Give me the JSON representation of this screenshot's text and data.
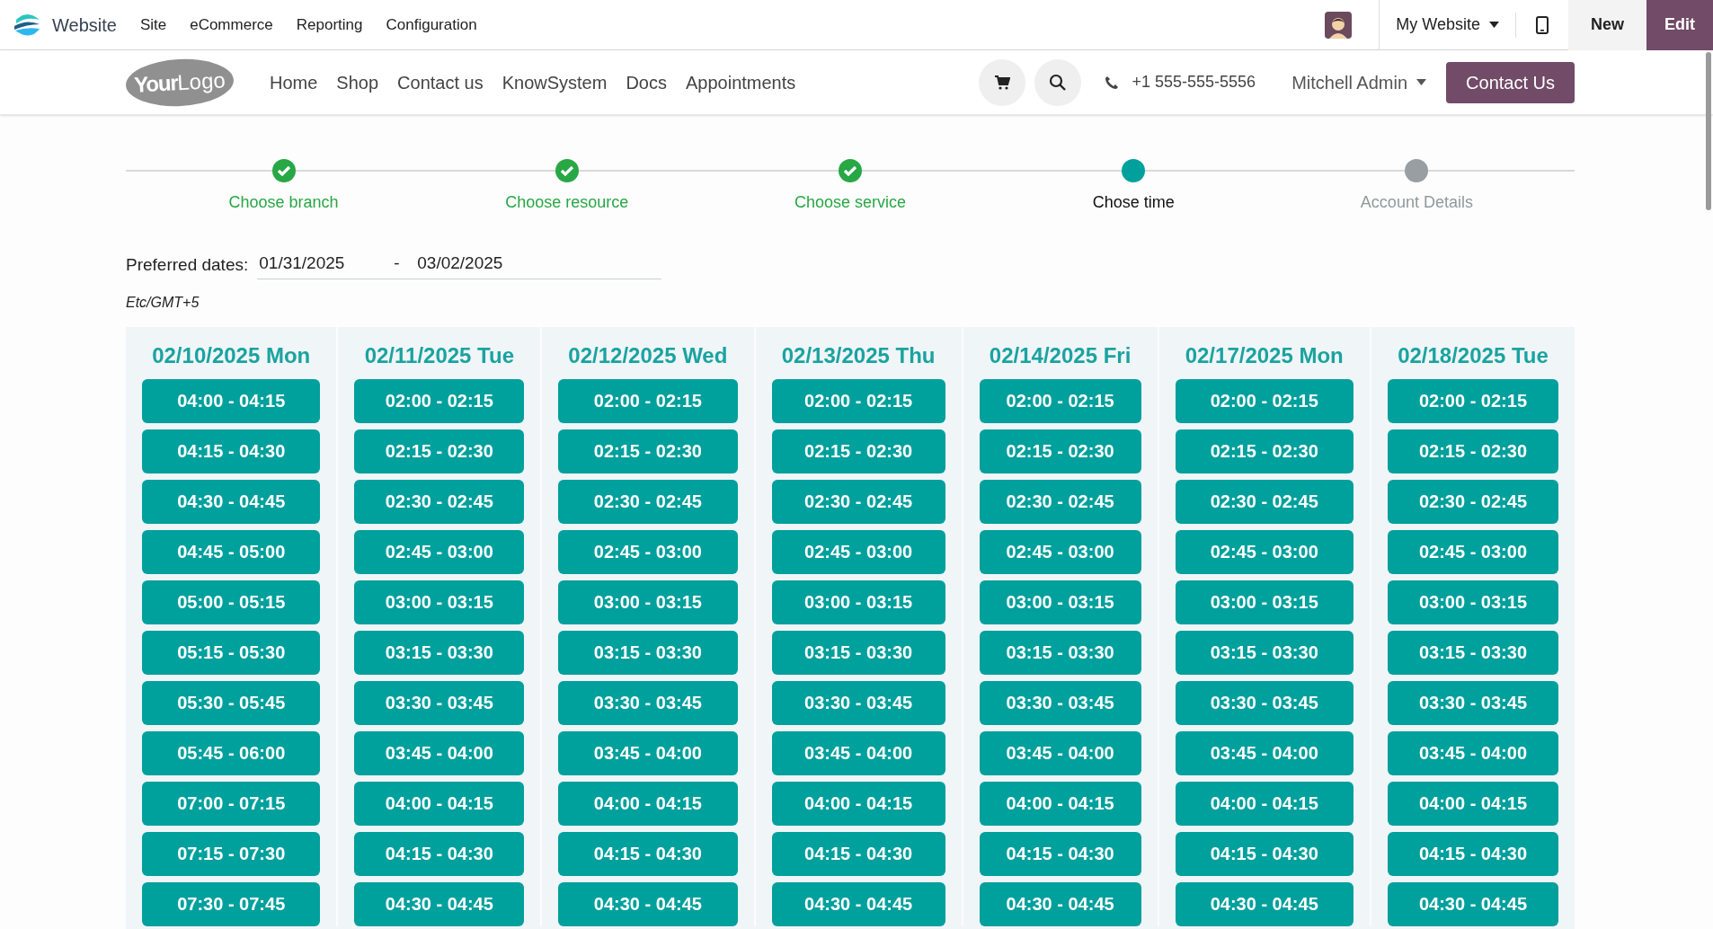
{
  "top_bar": {
    "app_name": "Website",
    "menu": [
      "Site",
      "eCommerce",
      "Reporting",
      "Configuration"
    ],
    "website_selector": "My Website",
    "buttons": [
      {
        "label": "New",
        "kind": "secondary"
      },
      {
        "label": "Edit",
        "kind": "primary"
      }
    ]
  },
  "header": {
    "logo": {
      "bold": "Your",
      "light": "Logo"
    },
    "nav": [
      "Home",
      "Shop",
      "Contact us",
      "KnowSystem",
      "Docs",
      "Appointments"
    ],
    "phone": "+1 555-555-5556",
    "user": "Mitchell Admin",
    "cta": "Contact Us"
  },
  "steps": [
    {
      "label": "Choose branch",
      "completed": true,
      "current": false
    },
    {
      "label": "Choose resource",
      "completed": true,
      "current": false
    },
    {
      "label": "Choose service",
      "completed": true,
      "current": false
    },
    {
      "label": "Chose time",
      "completed": false,
      "current": true
    },
    {
      "label": "Account Details",
      "completed": false,
      "current": false
    }
  ],
  "preferred_dates": {
    "label": "Preferred dates:",
    "from": "01/31/2025",
    "separator": "-",
    "to": "03/02/2025"
  },
  "timezone": "Etc/GMT+5",
  "days": [
    {
      "date": "02/10/2025 Mon",
      "slots": [
        "04:00 - 04:15",
        "04:15 - 04:30",
        "04:30 - 04:45",
        "04:45 - 05:00",
        "05:00 - 05:15",
        "05:15 - 05:30",
        "05:30 - 05:45",
        "05:45 - 06:00",
        "07:00 - 07:15",
        "07:15 - 07:30",
        "07:30 - 07:45"
      ]
    },
    {
      "date": "02/11/2025 Tue",
      "slots": [
        "02:00 - 02:15",
        "02:15 - 02:30",
        "02:30 - 02:45",
        "02:45 - 03:00",
        "03:00 - 03:15",
        "03:15 - 03:30",
        "03:30 - 03:45",
        "03:45 - 04:00",
        "04:00 - 04:15",
        "04:15 - 04:30",
        "04:30 - 04:45"
      ]
    },
    {
      "date": "02/12/2025 Wed",
      "slots": [
        "02:00 - 02:15",
        "02:15 - 02:30",
        "02:30 - 02:45",
        "02:45 - 03:00",
        "03:00 - 03:15",
        "03:15 - 03:30",
        "03:30 - 03:45",
        "03:45 - 04:00",
        "04:00 - 04:15",
        "04:15 - 04:30",
        "04:30 - 04:45"
      ]
    },
    {
      "date": "02/13/2025 Thu",
      "slots": [
        "02:00 - 02:15",
        "02:15 - 02:30",
        "02:30 - 02:45",
        "02:45 - 03:00",
        "03:00 - 03:15",
        "03:15 - 03:30",
        "03:30 - 03:45",
        "03:45 - 04:00",
        "04:00 - 04:15",
        "04:15 - 04:30",
        "04:30 - 04:45"
      ]
    },
    {
      "date": "02/14/2025 Fri",
      "slots": [
        "02:00 - 02:15",
        "02:15 - 02:30",
        "02:30 - 02:45",
        "02:45 - 03:00",
        "03:00 - 03:15",
        "03:15 - 03:30",
        "03:30 - 03:45",
        "03:45 - 04:00",
        "04:00 - 04:15",
        "04:15 - 04:30",
        "04:30 - 04:45"
      ]
    },
    {
      "date": "02/17/2025 Mon",
      "slots": [
        "02:00 - 02:15",
        "02:15 - 02:30",
        "02:30 - 02:45",
        "02:45 - 03:00",
        "03:00 - 03:15",
        "03:15 - 03:30",
        "03:30 - 03:45",
        "03:45 - 04:00",
        "04:00 - 04:15",
        "04:15 - 04:30",
        "04:30 - 04:45"
      ]
    },
    {
      "date": "02/18/2025 Tue",
      "slots": [
        "02:00 - 02:15",
        "02:15 - 02:30",
        "02:30 - 02:45",
        "02:45 - 03:00",
        "03:00 - 03:15",
        "03:15 - 03:30",
        "03:30 - 03:45",
        "03:45 - 04:00",
        "04:00 - 04:15",
        "04:15 - 04:30",
        "04:30 - 04:45"
      ]
    }
  ]
}
